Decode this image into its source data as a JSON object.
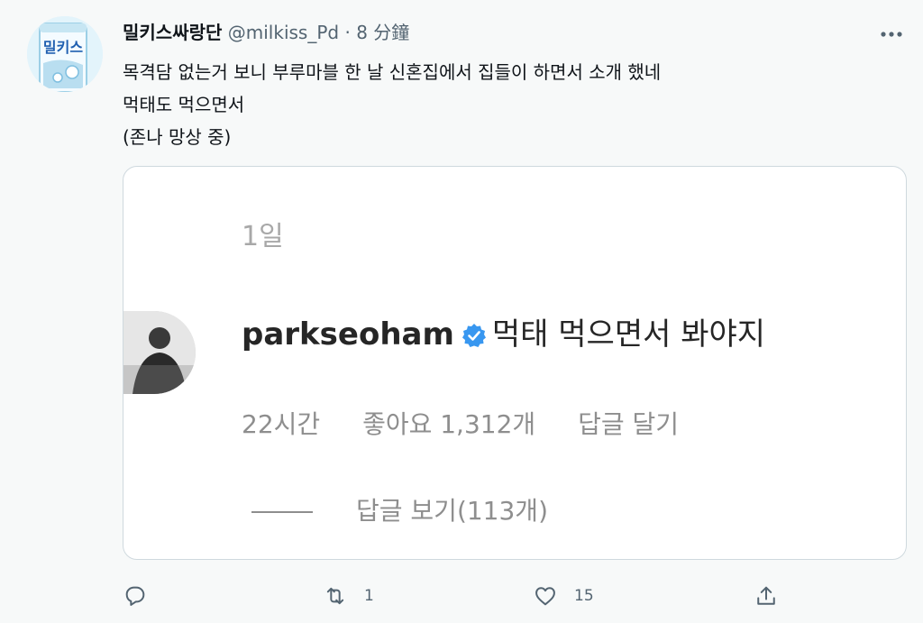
{
  "tweet": {
    "display_name": "밀키스싸랑단",
    "handle": "@milkiss_Pd",
    "separator": "·",
    "time": "8 分鐘",
    "lines": [
      "목격담 없는거 보니 부루마블 한 날 신혼집에서 집들이 하면서 소개 했네",
      "먹태도 먹으면서",
      "(존나 망상 중)"
    ],
    "avatar_icon": "milkis-can-avatar",
    "more_icon": "more-horizontal-icon"
  },
  "embedded_comment": {
    "date": "1일",
    "username": "parkseoham",
    "verified_icon": "verified-badge-icon",
    "text": "먹태 먹으면서 봐야지",
    "time_ago": "22시간",
    "likes": "좋아요 1,312개",
    "reply_action": "답글 달기",
    "view_replies": "답글 보기(113개)"
  },
  "actions": {
    "reply_icon": "reply-icon",
    "retweet_icon": "retweet-icon",
    "retweet_count": "1",
    "like_icon": "heart-icon",
    "like_count": "15",
    "share_icon": "share-icon"
  },
  "colors": {
    "background": "#f7f9f9",
    "secondary_text": "#536471",
    "verified_blue": "#3897f0",
    "instagram_gray": "#8e8e8e"
  }
}
